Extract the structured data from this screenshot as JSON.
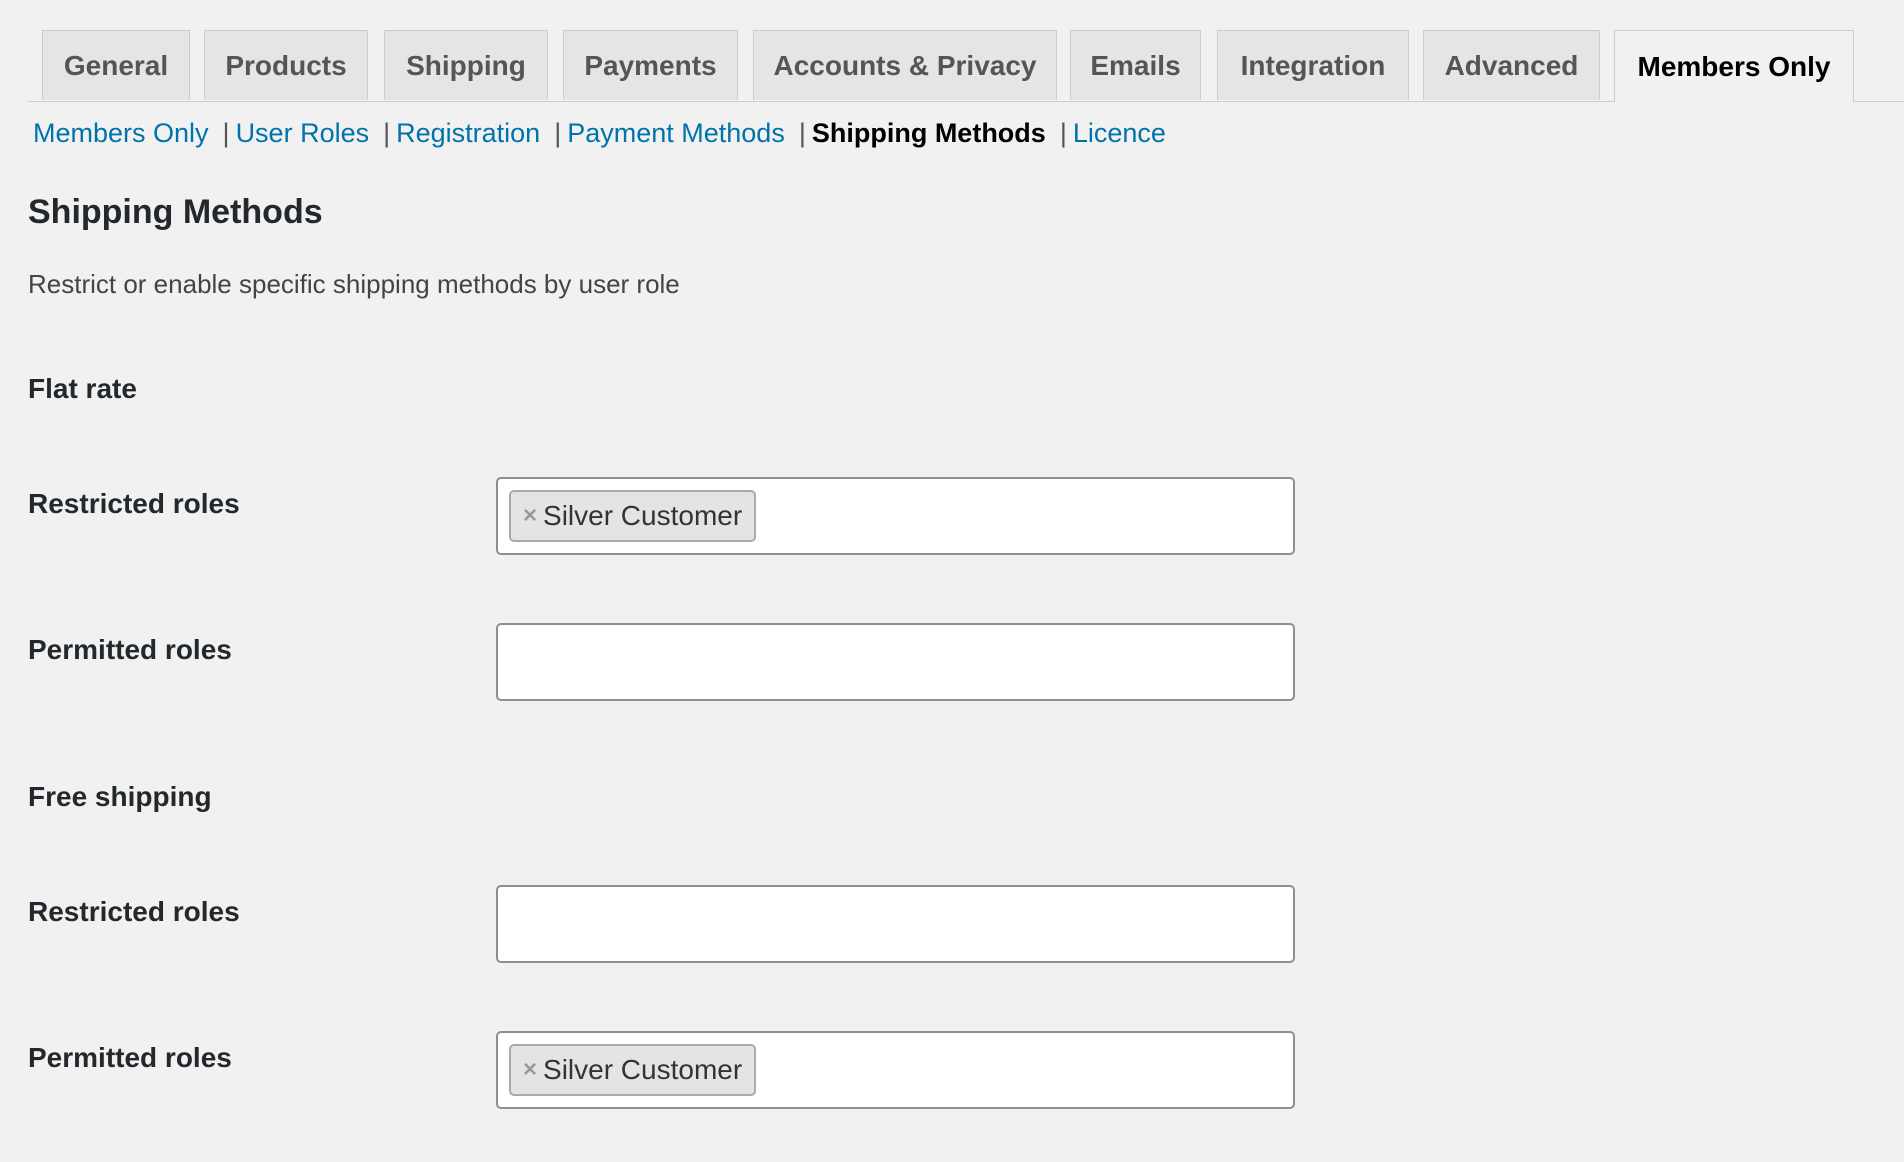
{
  "tabs": [
    {
      "label": "General",
      "active": false
    },
    {
      "label": "Products",
      "active": false
    },
    {
      "label": "Shipping",
      "active": false
    },
    {
      "label": "Payments",
      "active": false
    },
    {
      "label": "Accounts & Privacy",
      "active": false
    },
    {
      "label": "Emails",
      "active": false
    },
    {
      "label": "Integration",
      "active": false
    },
    {
      "label": "Advanced",
      "active": false
    },
    {
      "label": "Members Only",
      "active": true
    }
  ],
  "subnav": {
    "items": [
      {
        "label": "Members Only",
        "current": false
      },
      {
        "label": "User Roles",
        "current": false
      },
      {
        "label": "Registration",
        "current": false
      },
      {
        "label": "Payment Methods",
        "current": false
      },
      {
        "label": "Shipping Methods",
        "current": true
      },
      {
        "label": "Licence",
        "current": false
      }
    ],
    "separator": "|"
  },
  "page": {
    "title": "Shipping Methods",
    "description": "Restrict or enable specific shipping methods by user role"
  },
  "sections": [
    {
      "title": "Flat rate",
      "fields": [
        {
          "label": "Restricted roles",
          "selected": [
            "Silver Customer"
          ]
        },
        {
          "label": "Permitted roles",
          "selected": []
        }
      ]
    },
    {
      "title": "Free shipping",
      "fields": [
        {
          "label": "Restricted roles",
          "selected": []
        },
        {
          "label": "Permitted roles",
          "selected": [
            "Silver Customer"
          ]
        }
      ]
    }
  ],
  "chip_remove_glyph": "×",
  "colors": {
    "link": "#0073aa",
    "background": "#f1f1f1"
  }
}
